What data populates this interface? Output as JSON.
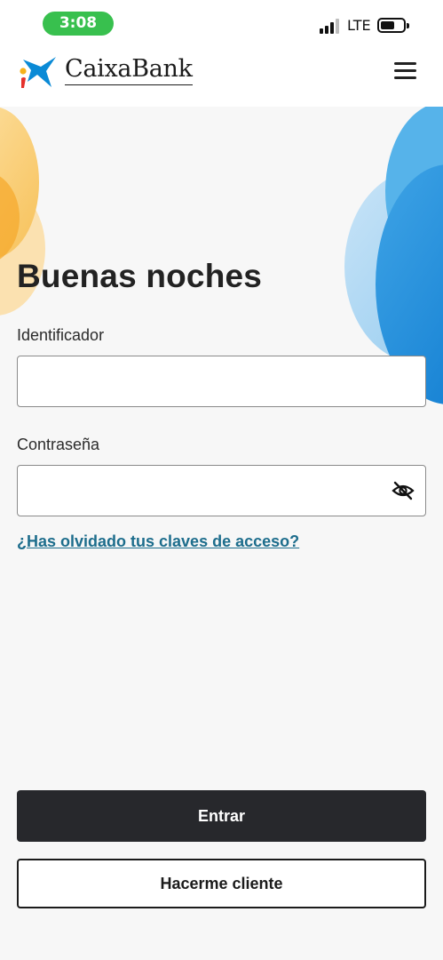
{
  "status_bar": {
    "time": "3:08",
    "network": "LTE",
    "time_pill_color": "#38c04e"
  },
  "header": {
    "brand": "CaixaBank",
    "logo_icon": "caixabank-star-logo",
    "menu_icon": "hamburger-menu-icon"
  },
  "login": {
    "greeting": "Buenas noches",
    "id_label": "Identificador",
    "id_value": "",
    "password_label": "Contraseña",
    "password_value": "",
    "password_toggle_icon": "eye-slash-icon",
    "forgot_link": "¿Has olvidado tus claves de acceso?",
    "submit_label": "Entrar",
    "signup_label": "Hacerme cliente"
  },
  "colors": {
    "primary_button": "#27282c",
    "link": "#1d6d8c",
    "brand_blue": "#0a8ad6",
    "brand_yellow": "#f6b21c"
  }
}
